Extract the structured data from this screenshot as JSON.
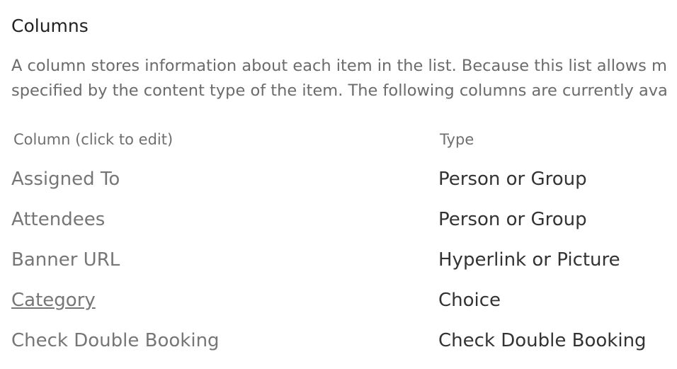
{
  "section": {
    "title": "Columns",
    "description_line1": "A column stores information about each item in the list. Because this list allows m",
    "description_line2": "specified by the content type of the item. The following columns are currently ava"
  },
  "table": {
    "headers": {
      "name": "Column (click to edit)",
      "type": "Type"
    },
    "rows": [
      {
        "name": "Assigned To",
        "type": "Person or Group"
      },
      {
        "name": "Attendees",
        "type": "Person or Group"
      },
      {
        "name": "Banner URL",
        "type": "Hyperlink or Picture"
      },
      {
        "name": "Category",
        "type": "Choice"
      },
      {
        "name": "Check Double Booking",
        "type": "Check Double Booking"
      }
    ]
  }
}
